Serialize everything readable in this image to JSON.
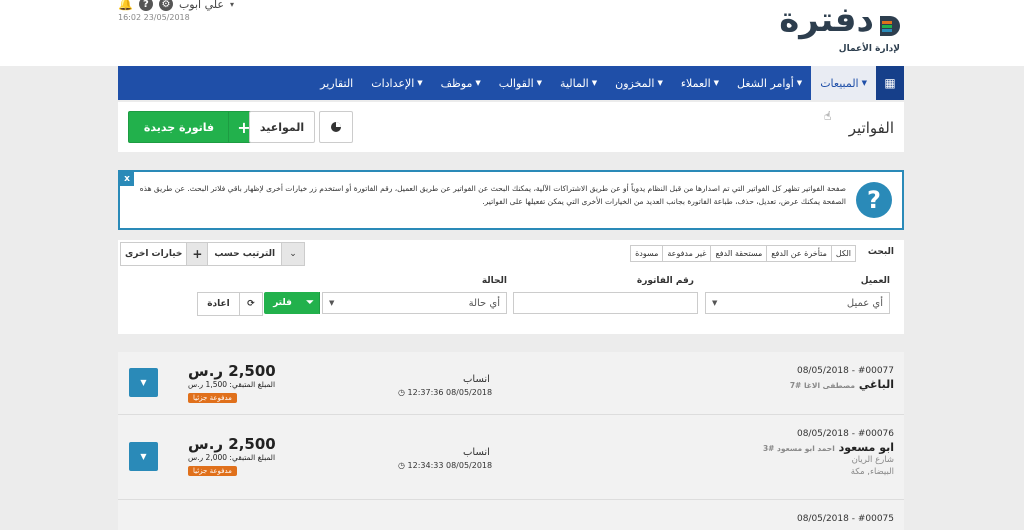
{
  "header": {
    "user_name": "علي ابوب",
    "datetime": "16:02 23/05/2018",
    "help_glyph": "?",
    "logo_text": "دفترة",
    "logo_subtitle": "لإدارة الأعمال"
  },
  "nav": {
    "items": [
      {
        "label": "المبيعات",
        "active": true
      },
      {
        "label": "أوامر الشغل"
      },
      {
        "label": "العملاء"
      },
      {
        "label": "المخزون"
      },
      {
        "label": "المالية"
      },
      {
        "label": "القوالب"
      },
      {
        "label": "موظف"
      },
      {
        "label": "الإعدادات"
      },
      {
        "label": "التقارير"
      }
    ]
  },
  "page": {
    "title": "الفواتير",
    "new_invoice": "فاتورة جديدة",
    "new_invoice_icon": "+",
    "appointments": "المواعيد"
  },
  "info": {
    "close": "x",
    "icon": "?",
    "text": "صفحة الفواتير تظهر كل الفواتير التي تم اصدارها من قبل النظام يدوياً أو عن طريق الاشتراكات الآلية، يمكنك البحث عن الفواتير عن طريق العميل، رقم الفاتورة أو استخدم زر خيارات أخرى لإظهار باقي فلاتر البحث. عن طريق هذه الصفحة يمكنك عرض، تعديل، حذف، طباعة الفاتورة بجانب العديد من الخيارات الأخرى التي يمكن تفعيلها على الفواتير."
  },
  "filter": {
    "search_label": "البحث",
    "tabs": [
      "الكل",
      "متأخرة عن الدفع",
      "مستحقة الدفع",
      "غير مدفوعة",
      "مسودة"
    ],
    "more_options": "خيارات اخرى",
    "more_options_icon": "+",
    "sort_label": "الترتيب حسب",
    "client_label": "العميل",
    "client_placeholder": "أي عميل",
    "invoice_no_label": "رقم الفاتورة",
    "invoice_no_value": "",
    "status_label": "الحالة",
    "status_placeholder": "أي حالة",
    "filter_button": "فلتر",
    "reset_button": "اعادة"
  },
  "invoices": [
    {
      "number": "#00077",
      "date": "08/05/2018",
      "client": "الباغي",
      "client_sub": "مصطفى الاغا #7",
      "address1": "",
      "address2": "",
      "created_by": "انساب",
      "created_time": "12:37:36 08/05/2018",
      "amount": "2,500 ر.س",
      "due": "المبلغ المتبقي: 1,500 ر.س",
      "badge": "مدفوعة جزئيا"
    },
    {
      "number": "#00076",
      "date": "08/05/2018",
      "client": "ابو مسعود",
      "client_sub": "احمد ابو مسعود #3",
      "address1": "شارع الريان",
      "address2": "البيضاء, مكة",
      "created_by": "انساب",
      "created_time": "12:34:33 08/05/2018",
      "amount": "2,500 ر.س",
      "due": "المبلغ المتبقي: 2,000 ر.س",
      "badge": "مدفوعة جزئيا"
    },
    {
      "number": "#00075",
      "date": "08/05/2018",
      "client": "",
      "client_sub": "",
      "address1": "",
      "address2": "",
      "created_by": "",
      "created_time": "",
      "amount": "",
      "due": "",
      "badge": ""
    }
  ]
}
